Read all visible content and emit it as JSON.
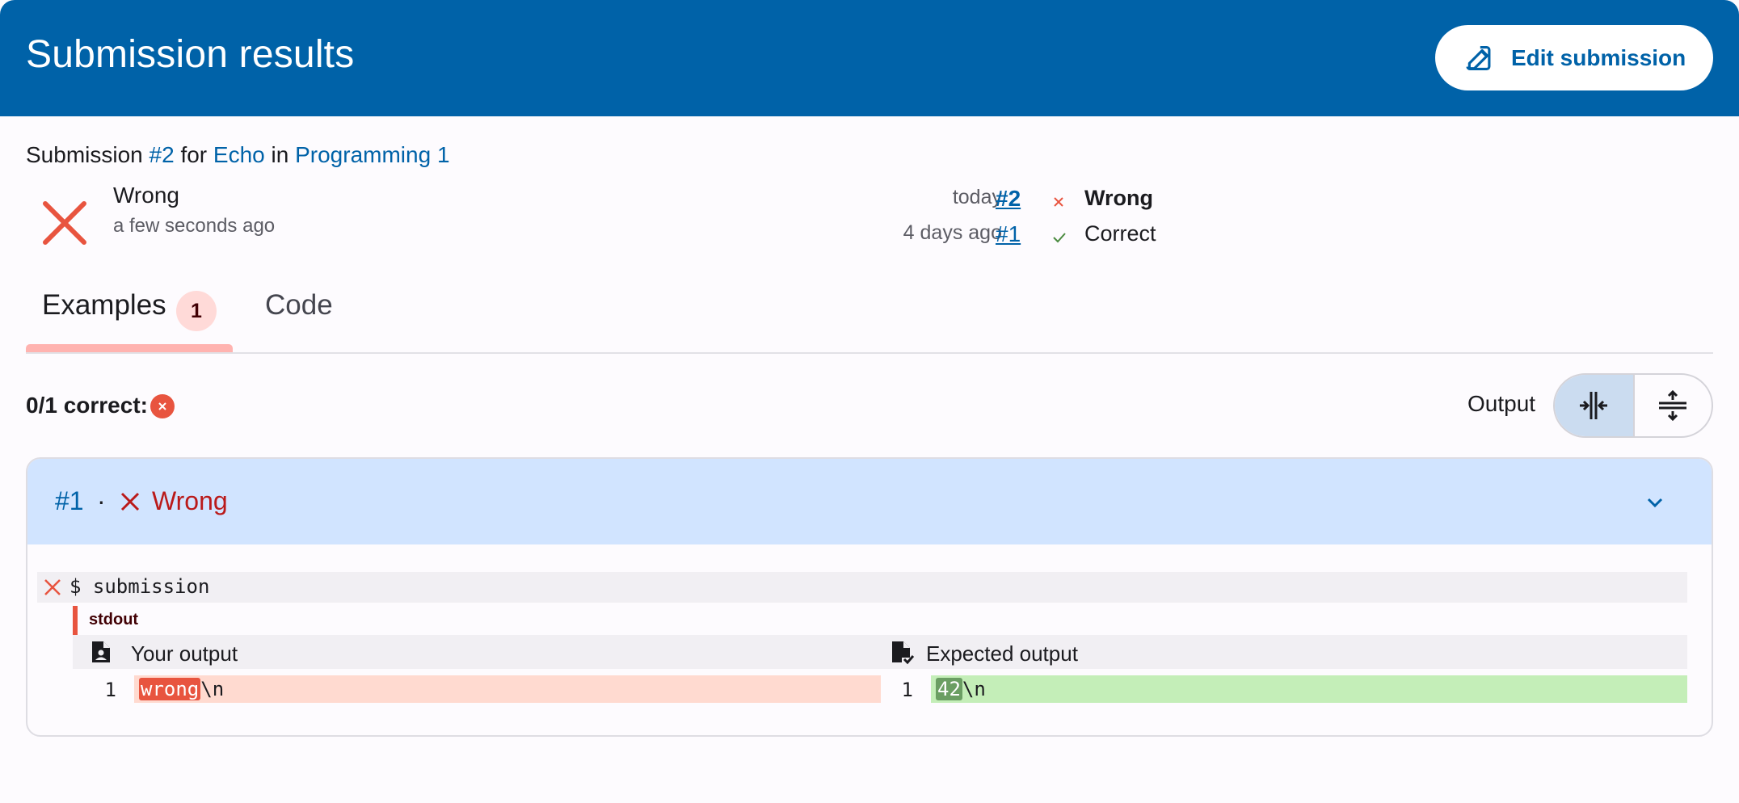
{
  "header": {
    "title": "Submission results",
    "edit_button": "Edit submission"
  },
  "subline": {
    "prefix": "Submission",
    "number": "#2",
    "for": "for",
    "exercise": "Echo",
    "in": "in",
    "course": "Programming 1"
  },
  "status": {
    "title": "Wrong",
    "time": "a few seconds ago"
  },
  "history": [
    {
      "date": "today",
      "number": "#2",
      "status": "Wrong",
      "correct": false
    },
    {
      "date": "4 days ago",
      "number": "#1",
      "status": "Correct",
      "correct": true
    }
  ],
  "tabs": {
    "examples": "Examples",
    "examples_badge": "1",
    "code": "Code"
  },
  "summary": {
    "correct_text": "0/1 correct:"
  },
  "output_toggle": {
    "label": "Output"
  },
  "testcase": {
    "number": "#1",
    "separator": "·",
    "status": "Wrong",
    "command": "$ submission",
    "channel": "stdout",
    "your_output_label": "Your output",
    "expected_output_label": "Expected output",
    "line_number": "1",
    "your_output_diff": "wrong",
    "your_output_rest": "\\n",
    "expected_output_diff": "42",
    "expected_output_rest": "\\n"
  },
  "colors": {
    "primary": "#0062a8",
    "wrong": "#e8543f",
    "correct": "#4a8a3f",
    "diff_removed_bg": "#ffdad0",
    "diff_added_bg": "#c4eeb8"
  }
}
